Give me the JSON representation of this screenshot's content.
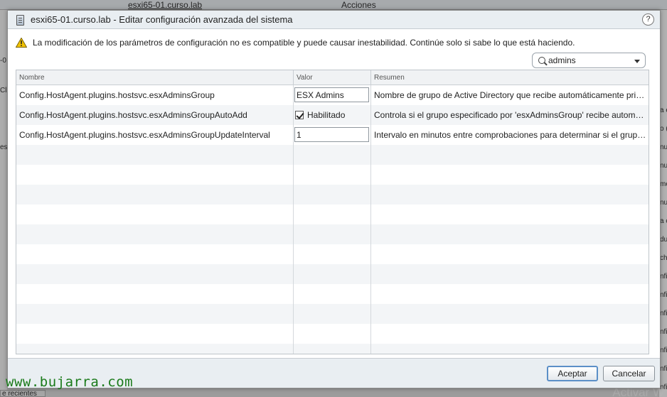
{
  "background": {
    "tab_label": "esxi65-01.curso.lab",
    "actions_label": "Acciones",
    "right_edge_fragments": [
      "a e",
      "o (",
      "nu",
      "nu",
      "me",
      "nu",
      "a c",
      "du",
      "ch",
      "nfi",
      "nfi",
      "nfi",
      "nfi",
      "nfi",
      "nfi",
      "nfi"
    ],
    "left_edge_fragments": [
      "-0",
      "Clu",
      "es"
    ],
    "bottom_tab_label": "e recientes",
    "corner_watermark": "Activar W"
  },
  "dialog": {
    "title": "esxi65-01.curso.lab - Editar configuración avanzada del sistema",
    "help_label": "?",
    "warning": "La modificación de los parámetros de configuración no es compatible y puede causar inestabilidad. Continúe solo si sabe lo que está haciendo.",
    "search": {
      "value": "admins"
    },
    "columns": {
      "name": "Nombre",
      "value": "Valor",
      "summary": "Resumen"
    },
    "rows": [
      {
        "name": "Config.HostAgent.plugins.hostsvc.esxAdminsGroup",
        "value": "ESX Admins",
        "summary": "Nombre de grupo de Active Directory que recibe automáticamente privilegios..."
      },
      {
        "name": "Config.HostAgent.plugins.hostsvc.esxAdminsGroupAutoAdd",
        "value": "Habilitado",
        "checked": true,
        "summary": "Controla si el grupo especificado por 'esxAdminsGroup' recibe automáticamente..."
      },
      {
        "name": "Config.HostAgent.plugins.hostsvc.esxAdminsGroupUpdateInterval",
        "value": "1",
        "summary": "Intervalo en minutos entre comprobaciones para determinar si el grupo..."
      }
    ],
    "buttons": {
      "ok": "Aceptar",
      "cancel": "Cancelar"
    }
  },
  "watermark": "www.bujarra.com"
}
